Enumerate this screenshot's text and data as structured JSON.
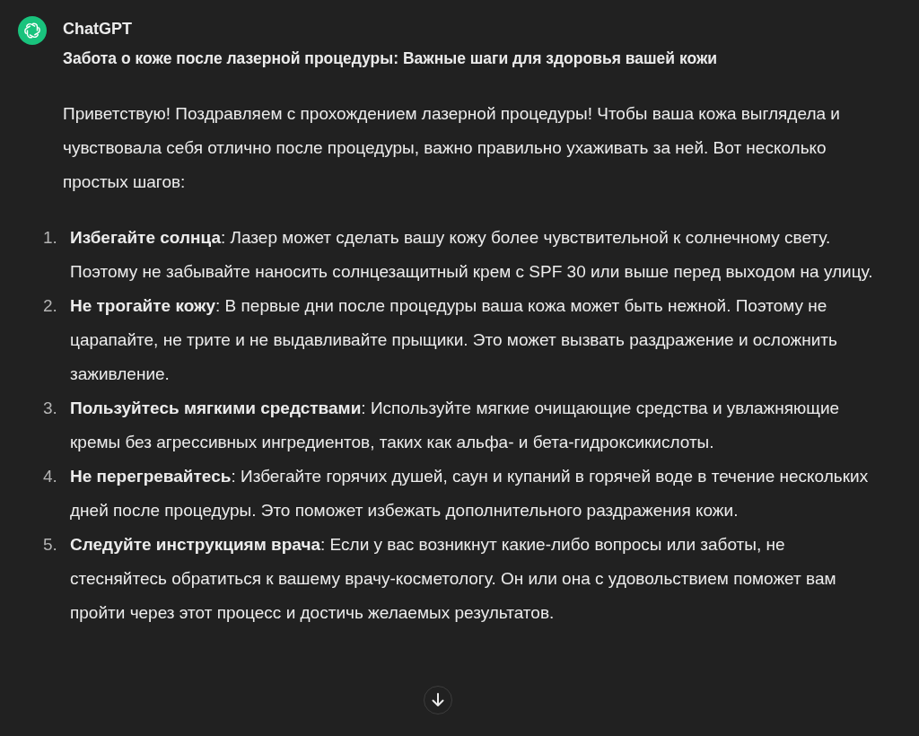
{
  "message": {
    "author": "ChatGPT",
    "title": "Забота о коже после лазерной процедуры: Важные шаги для здоровья вашей кожи",
    "intro": "Приветствую! Поздравляем с прохождением лазерной процедуры! Чтобы ваша кожа выглядела и чувствовала себя отлично после процедуры, важно правильно ухаживать за ней. Вот несколько простых шагов:",
    "steps": [
      {
        "number": "1.",
        "text": "**Избегайте солнца**: Лазер может сделать вашу кожу более чувствительной к солнечному свету. Поэтому не забывайте наносить солнцезащитный крем с SPF 30 или выше перед выходом на улицу."
      },
      {
        "number": "2.",
        "text": "**Не трогайте кожу**: В первые дни после процедуры ваша кожа может быть нежной. Поэтому не царапайте, не трите и не выдавливайте прыщики. Это может вызвать раздражение и осложнить заживление."
      },
      {
        "number": "3.",
        "text": "**Пользуйтесь мягкими средствами**: Используйте мягкие очищающие средства и увлажняющие кремы без агрессивных ингредиентов, таких как альфа- и бета-гидроксикислоты."
      },
      {
        "number": "4.",
        "text": "**Не перегревайтесь**: Избегайте горячих душей, саун и купаний в горячей воде в течение нескольких дней после процедуры. Это поможет избежать дополнительного раздражения кожи."
      },
      {
        "number": "5.",
        "text": "**Следуйте инструкциям врача**: Если у вас возникнут какие-либо вопросы или заботы, не стесняйтесь обратиться к вашему врачу-косметологу. Он или она с удовольствием поможет вам пройти через этот процесс и достичь желаемых результатов."
      }
    ]
  }
}
